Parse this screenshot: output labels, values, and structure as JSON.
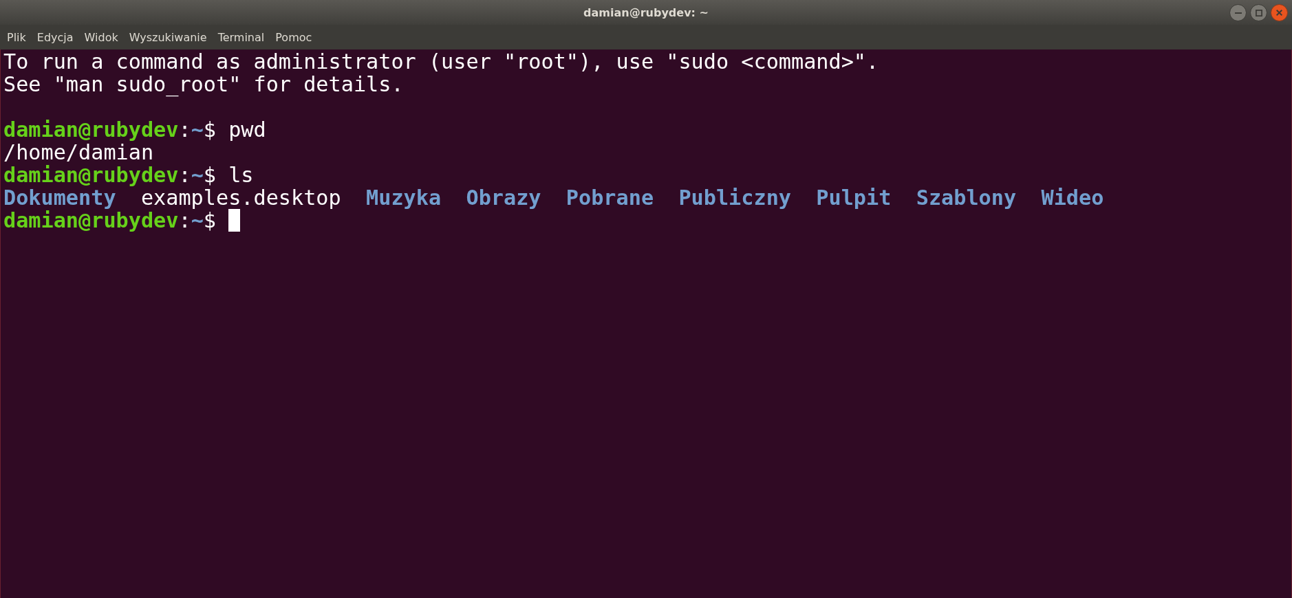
{
  "window": {
    "title": "damian@rubydev: ~",
    "buttons": [
      {
        "kind": "minimize"
      },
      {
        "kind": "maximize"
      },
      {
        "kind": "close"
      }
    ]
  },
  "menu": [
    "Plik",
    "Edycja",
    "Widok",
    "Wyszukiwanie",
    "Terminal",
    "Pomoc"
  ],
  "terminal": {
    "lines": [
      {
        "kind": "output",
        "segments": [
          {
            "kind": "text",
            "text": "To run a command as administrator (user \"root\"), use \"sudo <command>\"."
          }
        ]
      },
      {
        "kind": "output",
        "segments": [
          {
            "kind": "text",
            "text": "See \"man sudo_root\" for details."
          }
        ]
      },
      {
        "kind": "blank"
      },
      {
        "kind": "output",
        "segments": [
          {
            "kind": "user",
            "text": "damian@rubydev"
          },
          {
            "kind": "sep",
            "text": ":"
          },
          {
            "kind": "path",
            "text": "~"
          },
          {
            "kind": "sep",
            "text": "$"
          },
          {
            "kind": "command",
            "text": "pwd"
          }
        ]
      },
      {
        "kind": "output",
        "segments": [
          {
            "kind": "text",
            "text": "/home/damian"
          }
        ]
      },
      {
        "kind": "output",
        "segments": [
          {
            "kind": "user",
            "text": "damian@rubydev"
          },
          {
            "kind": "sep",
            "text": ":"
          },
          {
            "kind": "path",
            "text": "~"
          },
          {
            "kind": "sep",
            "text": "$"
          },
          {
            "kind": "command",
            "text": "ls"
          }
        ]
      },
      {
        "kind": "output",
        "segments": [
          {
            "kind": "dir",
            "text": "Dokumenty"
          },
          {
            "kind": "file",
            "text": "examples.desktop"
          },
          {
            "kind": "dir",
            "text": "Muzyka"
          },
          {
            "kind": "dir",
            "text": "Obrazy"
          },
          {
            "kind": "dir",
            "text": "Pobrane"
          },
          {
            "kind": "dir",
            "text": "Publiczny"
          },
          {
            "kind": "dir",
            "text": "Pulpit"
          },
          {
            "kind": "dir",
            "text": "Szablony"
          },
          {
            "kind": "dir",
            "text": "Wideo"
          }
        ]
      },
      {
        "kind": "output",
        "cursor": true,
        "segments": [
          {
            "kind": "user",
            "text": "damian@rubydev"
          },
          {
            "kind": "sep",
            "text": ":"
          },
          {
            "kind": "path",
            "text": "~"
          },
          {
            "kind": "sep",
            "text": "$"
          }
        ]
      }
    ]
  }
}
